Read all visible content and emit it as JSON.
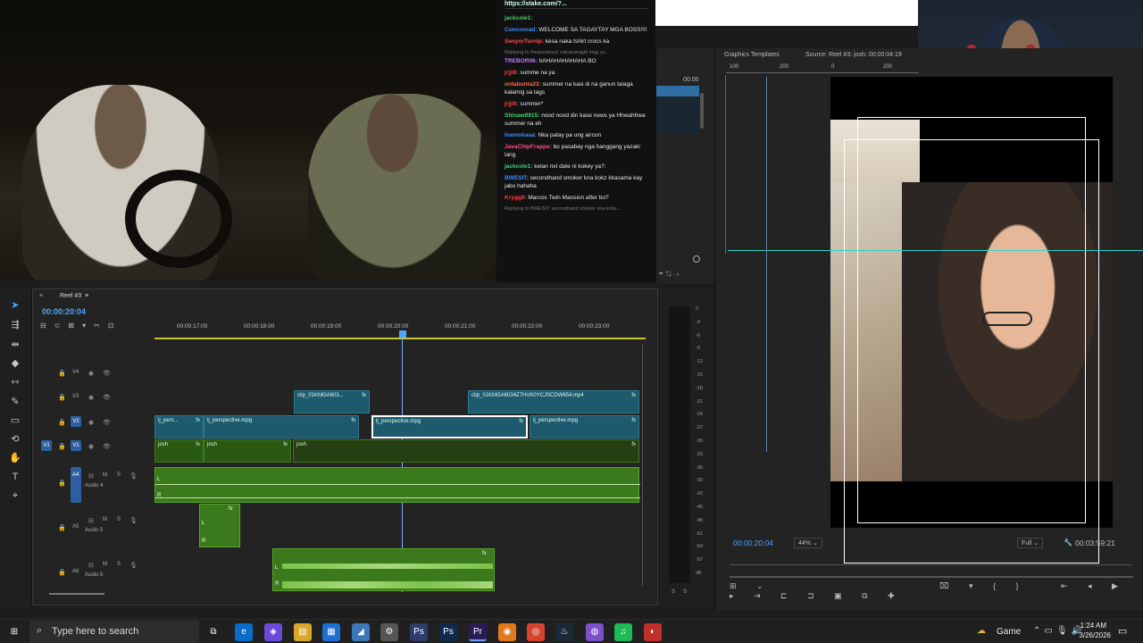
{
  "chat": {
    "url": "https://stake.com/?...",
    "messages": [
      {
        "user": "jackcole1:",
        "text": "",
        "color": "#3fd36a"
      },
      {
        "user": "Conconrad:",
        "text": "WELCOME SA TAGAYTAY MGA BOSS!!!!",
        "color": "#3a8dff"
      },
      {
        "user": "SenyorTurnip:",
        "text": "kesa naka tshirt crocs ka",
        "color": "#ff4d4d"
      },
      {
        "user": "",
        "text": "Replying to thegoodsaul: nakakainggit mag yo...",
        "color": "#777",
        "reply": true
      },
      {
        "user": "TREBOR06:",
        "text": "hAHAHAHAHAHA BO",
        "color": "#c27bff"
      },
      {
        "user": "jrjjl8:",
        "text": "summe na ya",
        "color": "#ff3b3b"
      },
      {
        "user": "ontabunta23:",
        "text": "summer na kasi di na ganun talaga kalamig sa tags",
        "color": "#ff6a3d"
      },
      {
        "user": "jrjjl8:",
        "text": "summer*",
        "color": "#ff3b3b"
      },
      {
        "user": "Shinaw0915:",
        "text": "nood nood din kase news ya Hhwahhwa summer na eh",
        "color": "#3fd36a"
      },
      {
        "user": "Inamokaaa:",
        "text": "Nka patay pa ung aircon",
        "color": "#3a8dff"
      },
      {
        "user": "JavaChipFrappe:",
        "text": "bo pasabay nga hanggang yazaki lang",
        "color": "#ff4d8d"
      },
      {
        "user": "jackcole1:",
        "text": "kelan nxt date ni kokey ya?:",
        "color": "#3fd36a"
      },
      {
        "user": "BWESIT:",
        "text": "secondhand smoker kna kokz kkasama kay jabo hahaha",
        "color": "#3a8dff"
      },
      {
        "user": "Krygg8:",
        "text": "Marcos Twin Mansion after bo?",
        "color": "#ff3b3b"
      },
      {
        "user": "",
        "text": "Replying to BWESIT: secondhand smoker kna koks...",
        "color": "#777",
        "reply": true
      }
    ]
  },
  "source_monitor": {
    "timecode": "00:00"
  },
  "program": {
    "tab_graphics": "Graphics Templates",
    "tab_source": "Source: Reel #3: josh: 00:00:04:19",
    "ruler_ticks": [
      "100",
      "200",
      "0",
      "200"
    ],
    "timecode": "00:00:20:04",
    "zoom": "44%",
    "quality": "Full",
    "duration": "00:03:59:21"
  },
  "timeline": {
    "sequence_name": "Reel #3",
    "timecode": "00:00:20:04",
    "ruler": [
      "00:00:17:00",
      "00:00:18:00",
      "00:00:19:00",
      "00:00:20:00",
      "00:00:21:00",
      "00:00:22:00",
      "00:00:23:00"
    ],
    "tracks": {
      "v4": "V4",
      "v3": "V3",
      "v2": "V2",
      "v1": "V1",
      "v1_src": "V1",
      "a4": "A4",
      "a4_name": "Audio 4",
      "a5": "A5",
      "a5_name": "Audio 5",
      "a6": "A6",
      "a6_name": "Audio 6"
    },
    "clips": {
      "v3_a": "clip_01KMGA603...",
      "v3_b": "clip_01KMGA6034Z7HVK0YCJSCDW654.mp4",
      "v2_a": "lj_pers...",
      "v2_b": "lj_perspective.mpg",
      "v2_c": "lj_perspective.mpg",
      "v2_d": "lj_perspective.mpg",
      "v1_a": "josh",
      "v1_b": "josh",
      "v1_c": "josh"
    },
    "fx": "fx",
    "msm": {
      "m": "M",
      "s": "S"
    },
    "audio_lr": {
      "l": "L",
      "r": "R"
    }
  },
  "meter": {
    "scale": [
      "0",
      "-3",
      "-6",
      "-9",
      "-12",
      "-15",
      "-18",
      "-21",
      "-24",
      "-27",
      "-30",
      "-33",
      "-36",
      "-39",
      "-42",
      "-45",
      "-48",
      "-51",
      "-54",
      "-57",
      "dB"
    ],
    "solo": "S",
    "solo2": "S"
  },
  "taskbar": {
    "search_placeholder": "Type here to search",
    "game_label": "Game",
    "time": "1:24 AM",
    "date": "3/26/2026"
  },
  "colors": {
    "accent_blue": "#3a8dff",
    "clip_teal": "#1d5a6e",
    "clip_green": "#2a5a12",
    "audio_green": "#3a7a1c"
  }
}
